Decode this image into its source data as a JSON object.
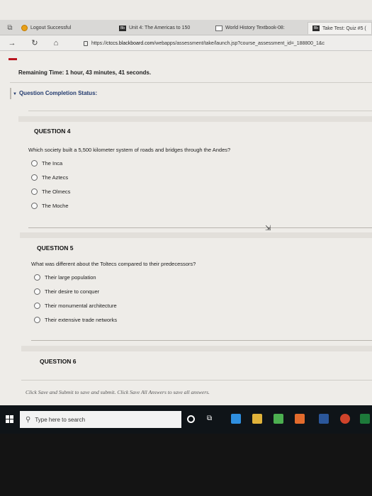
{
  "browser": {
    "tabs": [
      {
        "label": "Logout Successful"
      },
      {
        "label": "Unit 4: The Americas to 150"
      },
      {
        "label": "World History Textbook-08:"
      },
      {
        "label": "Take Test: Quiz #5 ("
      }
    ],
    "url_prefix": "https://",
    "url_host": "ctccs.blackboard.com",
    "url_path": "/webapps/assessment/take/launch.jsp?course_assessment_id=_188800_1&c"
  },
  "test": {
    "remaining_label": "Remaining Time:",
    "remaining_value": "1 hour, 43 minutes, 41 seconds.",
    "completion_status_label": "Question Completion Status:"
  },
  "questions": [
    {
      "title": "QUESTION 4",
      "text": "Which society built a 5,500 kilometer system of roads and bridges through the Andes?",
      "options": [
        "The Inca",
        "The Aztecs",
        "The Olmecs",
        "The Moche"
      ]
    },
    {
      "title": "QUESTION 5",
      "text": "What was different about the Toltecs compared to their predecessors?",
      "options": [
        "Their large population",
        "Their desire to conquer",
        "Their monumental architecture",
        "Their extensive trade networks"
      ]
    },
    {
      "title": "QUESTION 6"
    }
  ],
  "footer_note": "Click Save and Submit to save and submit. Click Save All Answers to save all answers.",
  "taskbar": {
    "search_placeholder": "Type here to search"
  },
  "colors": {
    "accent_red": "#b9141e",
    "status_blue": "#223a6e",
    "taskbar": "#0f1418"
  }
}
